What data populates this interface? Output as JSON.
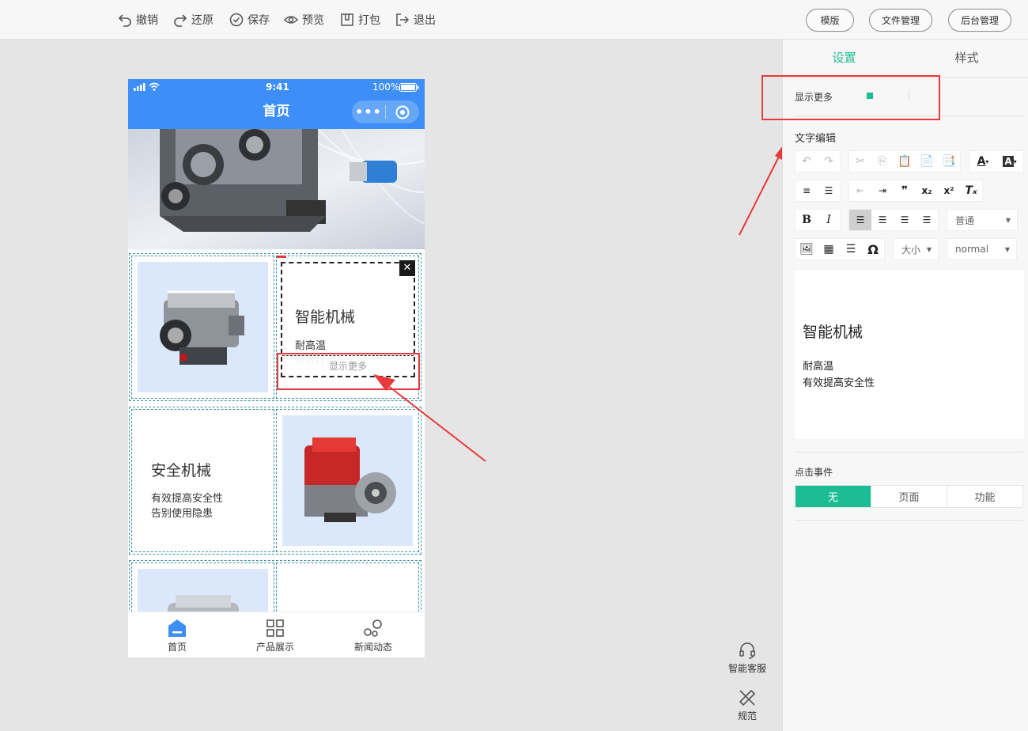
{
  "toolbar": {
    "undo": "撤销",
    "redo": "还原",
    "save": "保存",
    "preview": "预览",
    "package": "打包",
    "exit": "退出",
    "template": "模版",
    "files": "文件管理",
    "admin": "后台管理"
  },
  "phone": {
    "time": "9:41",
    "battery": "100%",
    "title": "首页",
    "cards": [
      {
        "title": "智能机械",
        "line1": "耐高温",
        "line2": "有效提高安全性",
        "more": "显示更多"
      },
      {
        "title": "安全机械",
        "line1": "有效提高安全性",
        "line2": "告别使用隐患"
      }
    ],
    "tabs": [
      {
        "label": "首页"
      },
      {
        "label": "产品展示"
      },
      {
        "label": "新闻动态"
      }
    ]
  },
  "panel": {
    "tab_settings": "设置",
    "tab_style": "样式",
    "show_more_label": "显示更多",
    "text_edit_label": "文字编辑",
    "format_select": "普通",
    "size_select": "大小",
    "font_select": "normal",
    "editor": {
      "title": "智能机械",
      "line1": "耐高温",
      "line2": "有效提高安全性"
    },
    "click_event_label": "点击事件",
    "events": [
      "无",
      "页面",
      "功能"
    ]
  },
  "side_tools": {
    "service": "智能客服",
    "spec": "规范"
  },
  "colors": {
    "accent": "#1dbd94",
    "phone_header": "#3d8ff7",
    "highlight": "#e8393b"
  }
}
